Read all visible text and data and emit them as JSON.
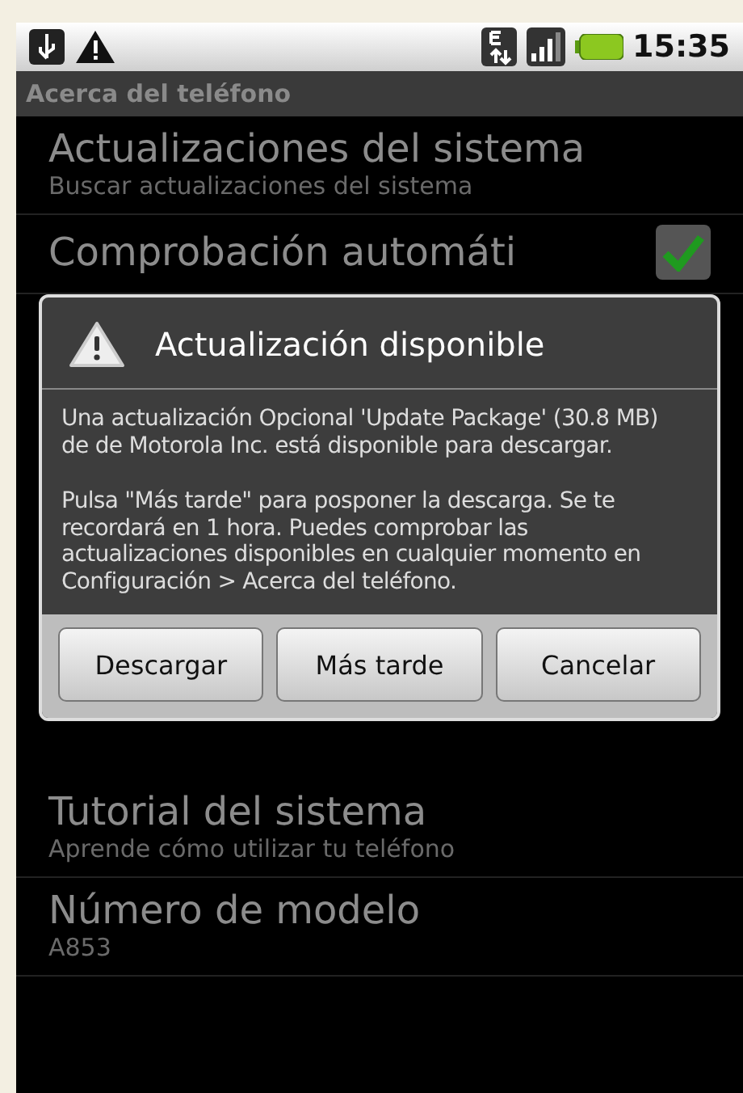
{
  "status_bar": {
    "time": "15:35"
  },
  "title_bar": {
    "title": "Acerca del teléfono"
  },
  "settings_top": [
    {
      "kind": "plain",
      "title": "Actualizaciones del sistema",
      "summary": "Buscar actualizaciones del sistema"
    },
    {
      "kind": "checkbox",
      "title": "Comprobación automáti",
      "checked": true
    }
  ],
  "dialog": {
    "title": "Actualización disponible",
    "paragraphs": [
      "Una actualización Opcional 'Update Package' (30.8 MB)  de  de Motorola Inc.  está disponible para descargar.",
      "Pulsa \"Más tarde\" para posponer la descarga. Se te recordará en 1 hora. Puedes comprobar las actualizaciones disponibles en cualquier momento en Configuración > Acerca del teléfono."
    ],
    "buttons": [
      "Descargar",
      "Más tarde",
      "Cancelar"
    ]
  },
  "settings_bottom": [
    {
      "kind": "plain",
      "title": "Tutorial del sistema",
      "summary": "Aprende cómo utilizar tu teléfono"
    },
    {
      "kind": "plain",
      "title": "Número de modelo",
      "summary": "A853"
    }
  ]
}
